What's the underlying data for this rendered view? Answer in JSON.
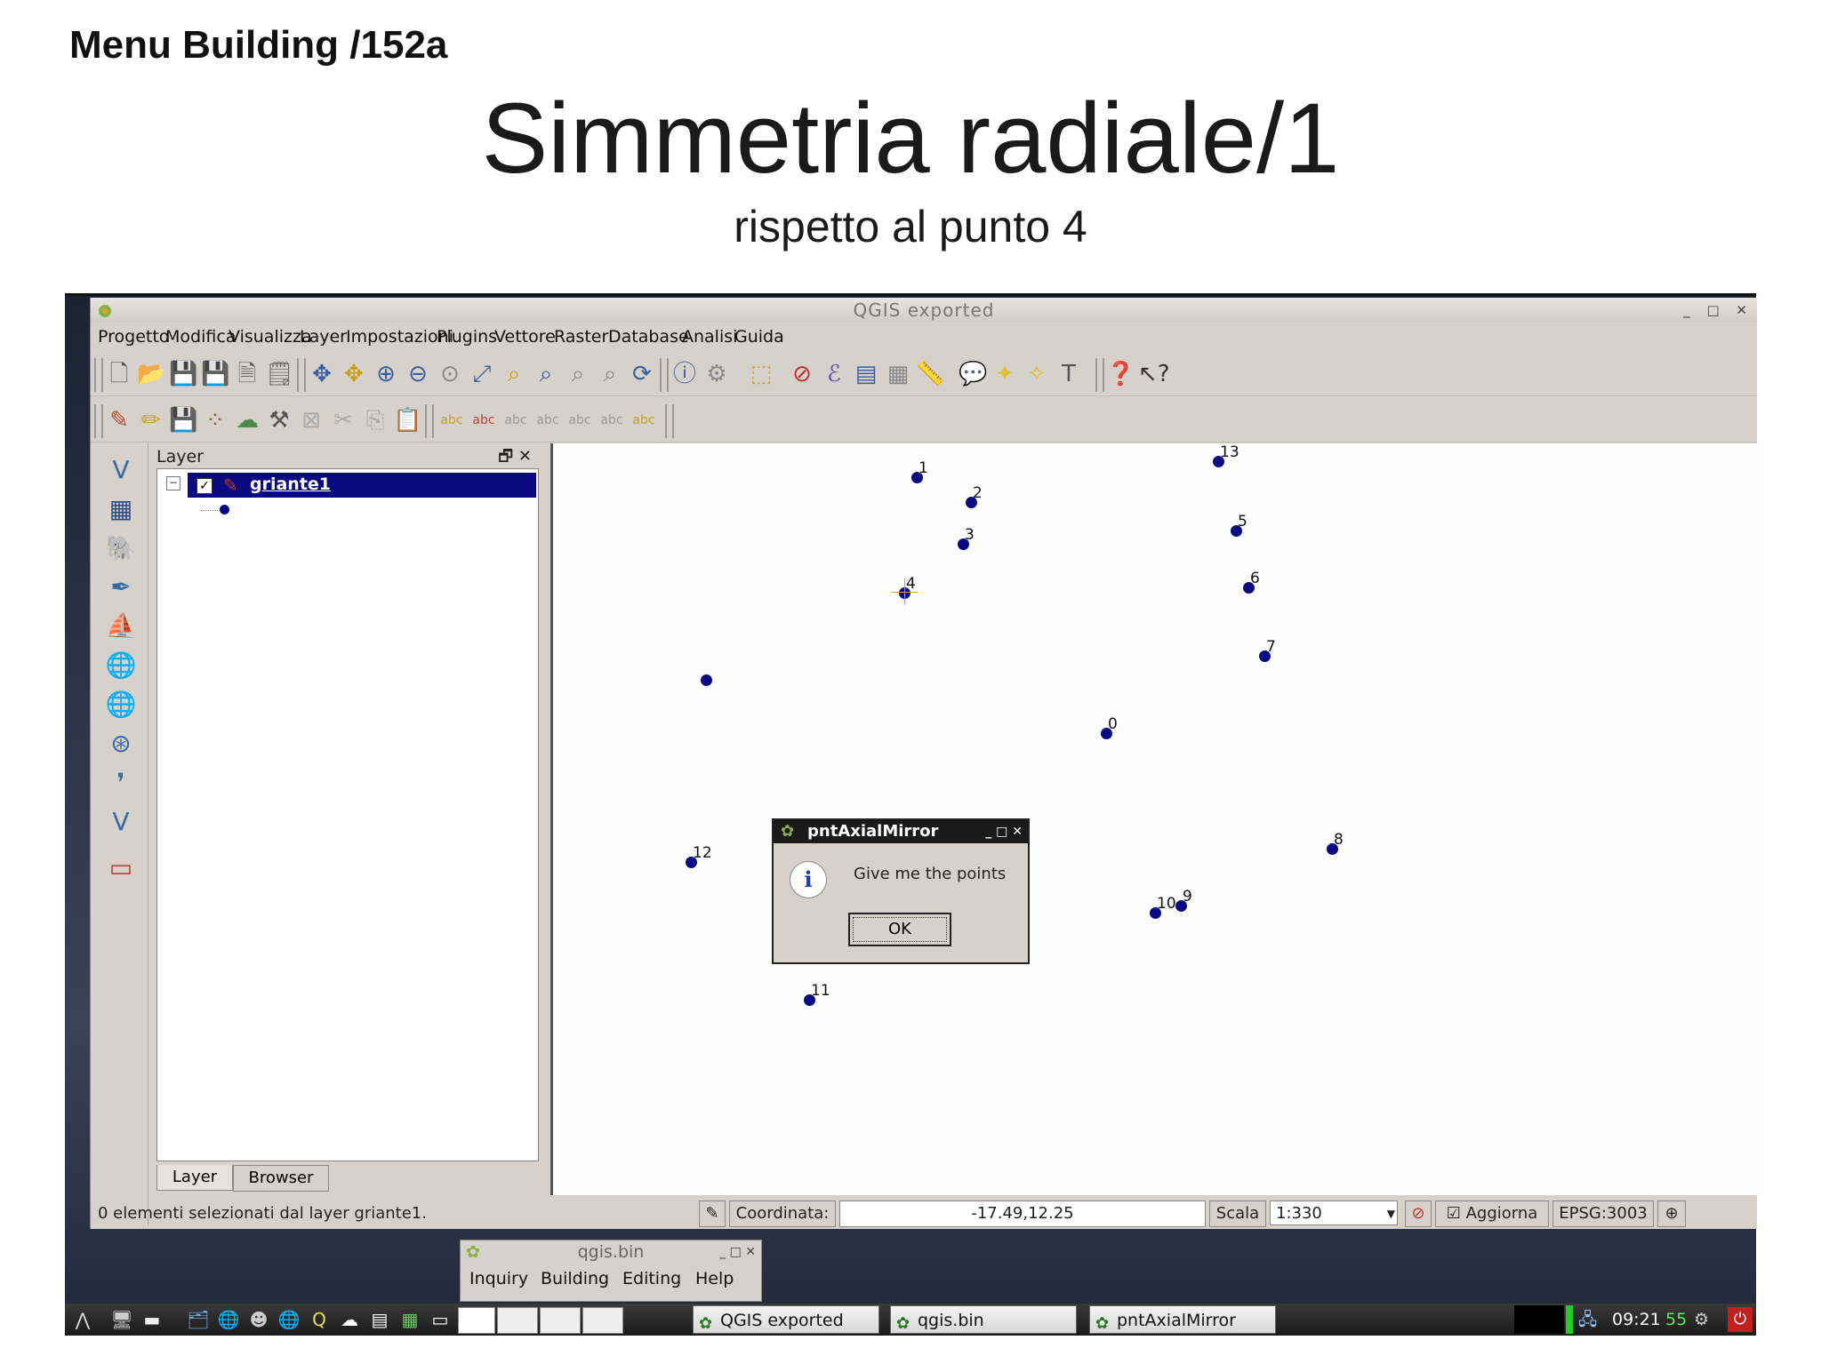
{
  "slide": {
    "header": "Menu Building /152a",
    "title": "Simmetria radiale/1",
    "subtitle": "rispetto al punto 4"
  },
  "qgis": {
    "window_title": "QGIS exported",
    "menu": [
      "Progetto",
      "Modifica",
      "Visualizza",
      "Layer",
      "Impostazioni",
      "Plugins",
      "Vettore",
      "Raster",
      "Database",
      "Analisi",
      "Guida"
    ],
    "layer_panel": {
      "title": "Layer",
      "layer_name": "griante1",
      "tabs": [
        "Layer",
        "Browser"
      ]
    },
    "map_points": [
      {
        "label": "1"
      },
      {
        "label": "2"
      },
      {
        "label": "3"
      },
      {
        "label": "4"
      },
      {
        "label": "5"
      },
      {
        "label": "6"
      },
      {
        "label": "7"
      },
      {
        "label": "0"
      },
      {
        "label": "8"
      },
      {
        "label": "9"
      },
      {
        "label": "10"
      },
      {
        "label": "11"
      },
      {
        "label": "12"
      },
      {
        "label": "13"
      },
      {
        "label": ""
      }
    ],
    "dialog": {
      "title": "pntAxialMirror",
      "message": "Give me the points",
      "ok": "OK"
    },
    "status": {
      "message": "0 elementi selezionati dal layer griante1.",
      "coord_label": "Coordinata:",
      "coord_value": "-17.49,12.25",
      "scale_label": "Scala",
      "scale_value": "1:330",
      "refresh_label": "Aggiorna",
      "crs": "EPSG:3003"
    }
  },
  "plugin_window": {
    "title": "qgis.bin",
    "menu": [
      "Inquiry",
      "Building",
      "Editing",
      "Help"
    ]
  },
  "taskbar": {
    "tasks": [
      "QGIS exported",
      "qgis.bin",
      "pntAxialMirror"
    ],
    "clock": "09:21",
    "seconds": "55"
  },
  "colors": {
    "selection": "#0a0a80",
    "point": "#0a0a80",
    "dialog_title_bg": "#1a1a1a"
  }
}
